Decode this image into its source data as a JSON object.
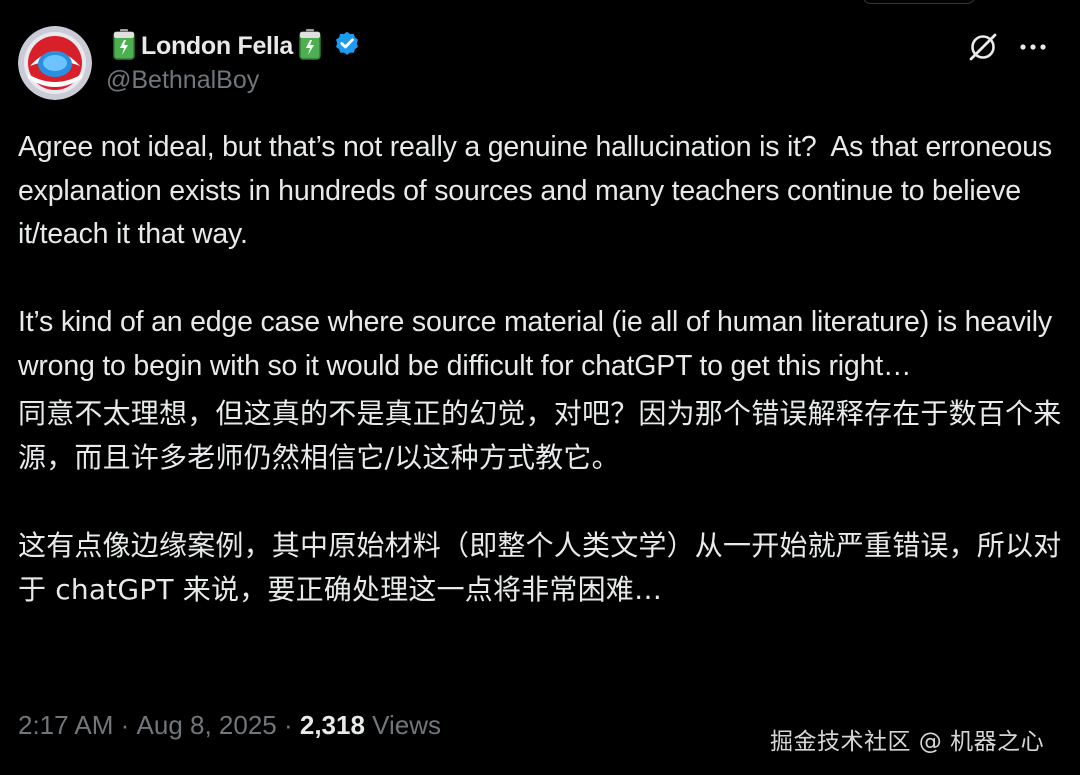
{
  "author": {
    "display_name": "London Fella",
    "handle": "@BethnalBoy",
    "verified": true,
    "name_emoji": "battery-icon"
  },
  "header_actions": {
    "grok_icon": "grok-icon",
    "more_icon": "more-options-icon"
  },
  "tweet": {
    "paragraph_1": "Agree not ideal, but that’s not really a genuine hallucination is it?  As that erroneous explanation exists in hundreds of sources and many teachers continue to believe it/teach it that way.",
    "paragraph_2": "It’s kind of an edge case where source material (ie all of human literature) is heavily wrong to begin with so it would be difficult for chatGPT to get this right…",
    "translation_1": "同意不太理想，但这真的不是真正的幻觉，对吧？因为那个错误解释存在于数百个来源，而且许多老师仍然相信它/以这种方式教它。",
    "translation_2": "这有点像边缘案例，其中原始材料（即整个人类文学）从一开始就严重错误，所以对于 chatGPT 来说，要正确处理这一点将非常困难…"
  },
  "meta": {
    "time": "2:17 AM",
    "separator": " · ",
    "date": "Aug 8, 2025",
    "views_count": "2,318",
    "views_label": " Views"
  },
  "watermark": "掘金技术社区 @ 机器之心",
  "colors": {
    "background": "#000000",
    "text_primary": "#e7e9ea",
    "text_secondary": "#71767b",
    "verified_blue": "#1d9bf0"
  }
}
